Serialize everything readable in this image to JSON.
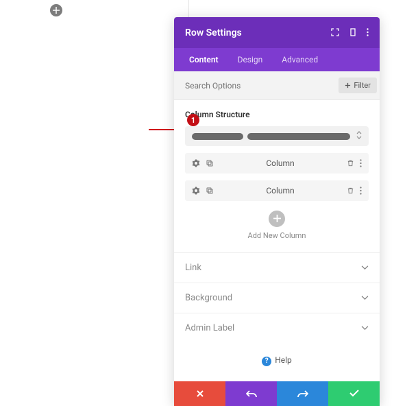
{
  "header": {
    "title": "Row Settings"
  },
  "tabs": {
    "content": "Content",
    "design": "Design",
    "advanced": "Advanced"
  },
  "search": {
    "placeholder": "Search Options",
    "filter_label": "Filter"
  },
  "column_structure": {
    "title": "Column Structure"
  },
  "columns": [
    {
      "label": "Column"
    },
    {
      "label": "Column"
    }
  ],
  "add_new": {
    "label": "Add New Column"
  },
  "accordion": {
    "link": "Link",
    "background": "Background",
    "admin_label": "Admin Label"
  },
  "help": {
    "label": "Help"
  },
  "annotation": {
    "badge": "1"
  }
}
